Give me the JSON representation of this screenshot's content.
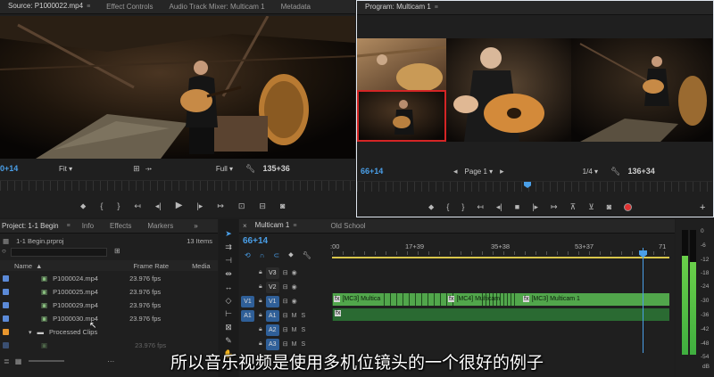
{
  "source": {
    "tabs": [
      "Source: P1000022.mp4",
      "Effect Controls",
      "Audio Track Mixer: Multicam 1",
      "Metadata"
    ],
    "timecode": "0+14",
    "fit": "Fit",
    "full": "Full",
    "duration": "135+36"
  },
  "program": {
    "tab": "Program: Multicam 1",
    "timecode": "66+14",
    "page": "Page 1",
    "page_fraction": "1/4",
    "duration": "136+34"
  },
  "project": {
    "tabs": [
      "Project: 1-1 Begin",
      "Info",
      "Effects",
      "Markers"
    ],
    "file": "1-1 Begin.prproj",
    "count": "13 Items",
    "columns": [
      "Name",
      "Frame Rate",
      "Media"
    ],
    "rows": [
      {
        "name": "P1000024.mp4",
        "rate": "23.976 fps"
      },
      {
        "name": "P1000025.mp4",
        "rate": "23.976 fps"
      },
      {
        "name": "P1000029.mp4",
        "rate": "23.976 fps"
      },
      {
        "name": "P1000030.mp4",
        "rate": "23.976 fps"
      }
    ],
    "folder": "Processed Clips",
    "folder_row_rate": "23.976 fps"
  },
  "timeline": {
    "tabs": [
      "Multicam 1",
      "Old School"
    ],
    "timecode": "66+14",
    "ruler": [
      ":00",
      "17+39",
      "35+38",
      "53+37",
      "71"
    ],
    "tracks": [
      "V3",
      "V2",
      "V1",
      "A1",
      "A2",
      "A3"
    ],
    "src_v1": "V1",
    "src_a1": "A1",
    "clips": [
      "[MC3] Multica",
      "[MC4] Multicam",
      "[MC3] Multicam 1"
    ]
  },
  "meter": {
    "scale": [
      "0",
      "-6",
      "-12",
      "-18",
      "-24",
      "-30",
      "-36",
      "-42",
      "-48",
      "-54"
    ],
    "unit": "dB",
    "levels": [
      0.79,
      0.74
    ]
  },
  "subtitle": "所以音乐视频是使用多机位镜头的一个很好的例子",
  "colors": {
    "accent": "#4a9fe8",
    "clip": "#51a64b",
    "audio_clip": "#2a6a32",
    "program_border": "#dfe6ee"
  }
}
